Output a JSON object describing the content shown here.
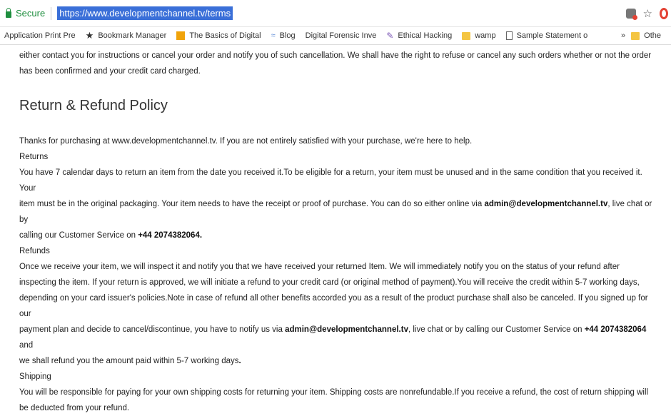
{
  "browser": {
    "secure_label": "Secure",
    "url": "https://www.developmentchannel.tv/terms"
  },
  "bookmarks": [
    {
      "label": "Application Print Pre",
      "icon": "page-icon"
    },
    {
      "label": "Bookmark Manager",
      "icon": "star-icon"
    },
    {
      "label": "The Basics of Digital",
      "icon": "orange-square-icon"
    },
    {
      "label": "Blog",
      "icon": "blog-icon"
    },
    {
      "label": "Digital Forensic Inve",
      "icon": "page-icon"
    },
    {
      "label": "Ethical Hacking",
      "icon": "hacker-icon"
    },
    {
      "label": "wamp",
      "icon": "folder-icon"
    },
    {
      "label": "Sample Statement o",
      "icon": "document-icon"
    },
    {
      "label": "»",
      "icon": "overflow-chevron"
    },
    {
      "label": "Othe",
      "icon": "folder-icon"
    }
  ],
  "content": {
    "intro_line_1": "either contact you for instructions or cancel your order and notify you of such cancellation. We shall have the right to refuse or cancel any such orders whether or not the order",
    "intro_line_2": "has been confirmed and your credit card charged.",
    "heading": "Return & Refund Policy",
    "thanks": "Thanks for purchasing at www.developmentchannel.tv. If you are not entirely satisfied with your purchase, we're here to help.",
    "returns_title": "Returns",
    "returns_text_1": "You have 7 calendar days to return an item from the date you received it.To be eligible for a return, your item must be unused and in the same condition that you received it. Your",
    "returns_text_2": "item must be in the original packaging. Your item needs to have the receipt or proof of purchase. You can do so either online via ",
    "returns_email": "admin@developmentchannel.tv",
    "returns_text_3": ", live chat or by",
    "returns_text_4": "calling our Customer Service on ",
    "returns_phone": "+44 2074382064.",
    "refunds_title": "Refunds",
    "refunds_text_1": "Once we receive your item, we will inspect it and notify you that we have received your returned Item. We will immediately notify you on the status of your refund after",
    "refunds_text_2": "inspecting the item. If your return is approved, we will initiate a refund to your credit card (or original method of payment).You will receive the credit within 5-7 working days,",
    "refunds_text_3": "depending on your card issuer's policies.Note in case of refund all other benefits accorded you as a result of the product purchase shall also be canceled. If you signed up for our",
    "refunds_text_4": "payment plan and decide to cancel/discontinue, you have to notify us via ",
    "refunds_email": "admin@developmentchannel.tv",
    "refunds_text_5": ", live chat or by calling our Customer Service on ",
    "refunds_phone": "+44 2074382064",
    "refunds_text_6": " and",
    "refunds_text_7": "we shall refund you the amount paid within 5-7 working days",
    "refunds_text_7_end": ".",
    "shipping_title": "Shipping",
    "shipping_text_1": "You will be responsible for paying for your own shipping costs for returning your item. Shipping costs are nonrefundable.If you receive a refund, the cost of return shipping will",
    "shipping_text_2": "be deducted from your refund."
  }
}
